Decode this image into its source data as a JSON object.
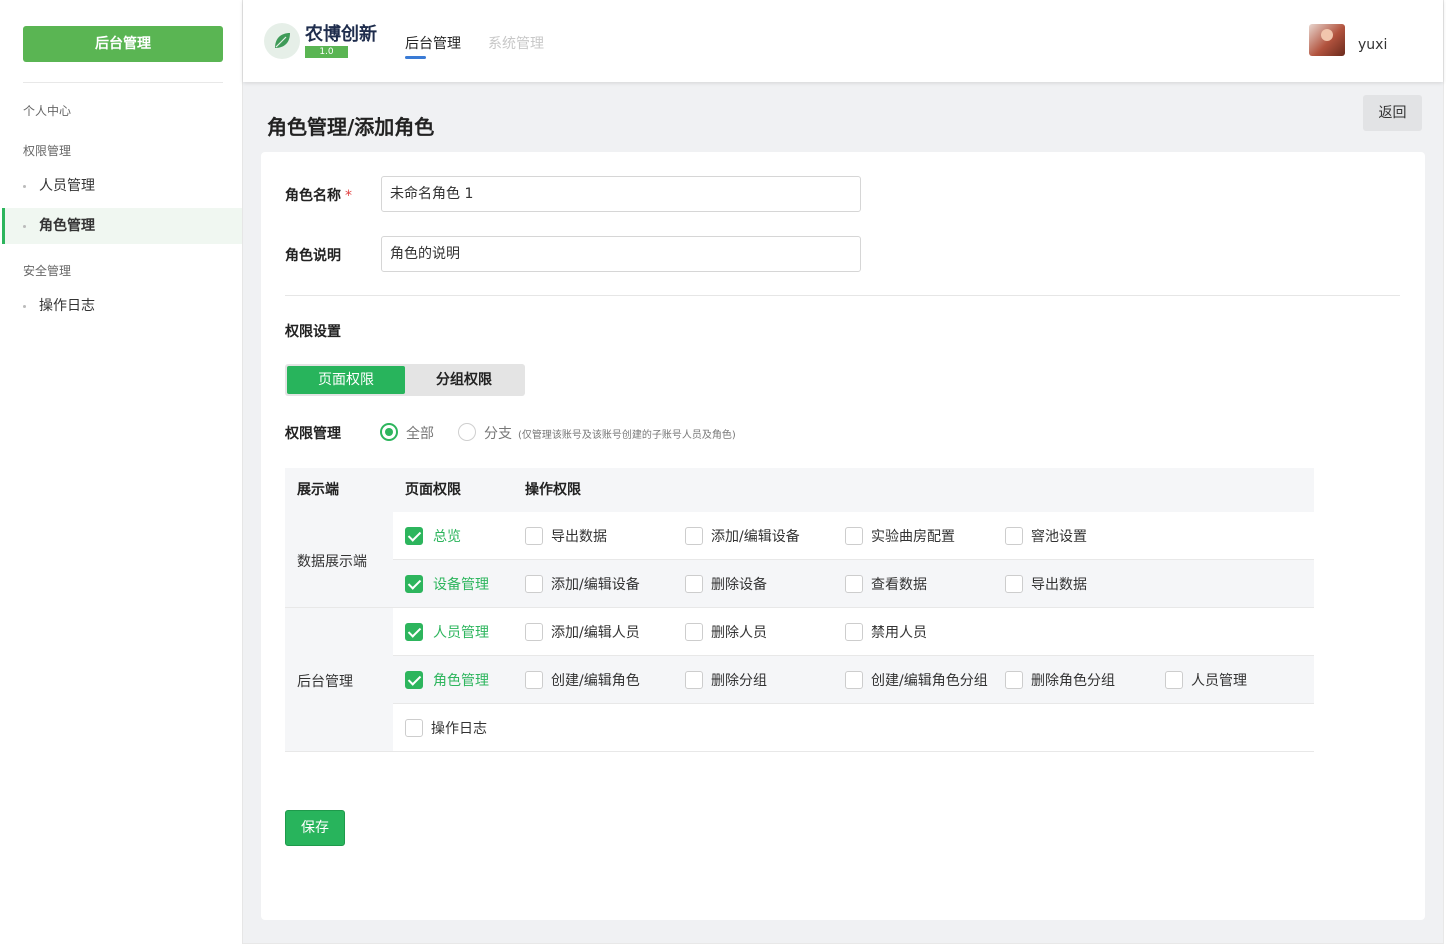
{
  "sidebar": {
    "top_button": "后台管理",
    "groups": [
      {
        "label": "个人中心"
      },
      {
        "label": "权限管理",
        "items": [
          "人员管理",
          "角色管理"
        ]
      },
      {
        "label": "安全管理",
        "items": [
          "操作日志"
        ]
      }
    ],
    "active_item": "角色管理"
  },
  "header": {
    "brand": "农博创新",
    "version": "1.0",
    "tabs": [
      "后台管理",
      "系统管理"
    ],
    "active_tab": "后台管理",
    "username": "yuxi"
  },
  "page": {
    "title": "角色管理/添加角色",
    "back_label": "返回"
  },
  "form": {
    "name_label": "角色名称",
    "required_mark": "*",
    "name_value": "未命名角色 1",
    "desc_label": "角色说明",
    "desc_value": "角色的说明",
    "perm_section": "权限设置",
    "seg_tabs": [
      "页面权限",
      "分组权限"
    ],
    "scope_label": "权限管理",
    "scope_options": [
      "全部",
      "分支"
    ],
    "scope_selected": "全部",
    "scope_note": "(仅管理该账号及该账号创建的子账号人员及角色)"
  },
  "table": {
    "headers": [
      "展示端",
      "页面权限",
      "操作权限"
    ],
    "groups": [
      "数据展示端",
      "后台管理"
    ],
    "rows": [
      {
        "page": "总览",
        "page_checked": true,
        "ops": [
          "导出数据",
          "添加/编辑设备",
          "实验曲房配置",
          "窨池设置"
        ]
      },
      {
        "page": "设备管理",
        "page_checked": true,
        "ops": [
          "添加/编辑设备",
          "删除设备",
          "查看数据",
          "导出数据"
        ]
      },
      {
        "page": "人员管理",
        "page_checked": true,
        "ops": [
          "添加/编辑人员",
          "删除人员",
          "禁用人员"
        ]
      },
      {
        "page": "角色管理",
        "page_checked": true,
        "ops": [
          "创建/编辑角色",
          "删除分组",
          "创建/编辑角色分组",
          "删除角色分组",
          "人员管理"
        ]
      },
      {
        "page": "操作日志",
        "page_checked": false,
        "ops": []
      }
    ]
  },
  "save_label": "保存",
  "colors": {
    "primary_green": "#2db55d",
    "nav_underline": "#3a7bd5",
    "required": "#e04040"
  }
}
